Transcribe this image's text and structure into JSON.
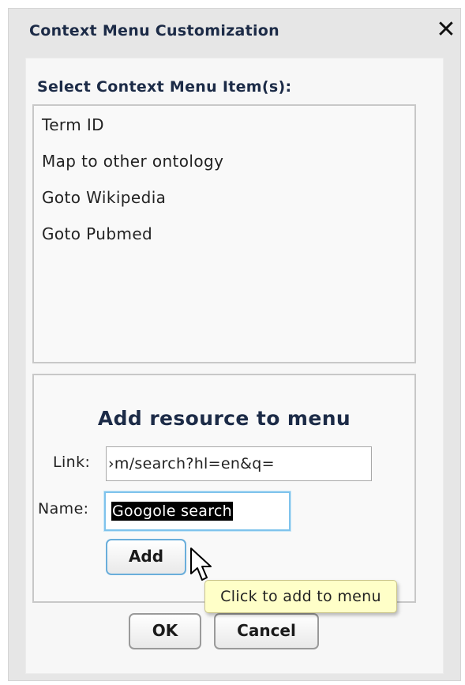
{
  "dialog": {
    "title": "Context Menu Customization",
    "close_icon": "close-icon"
  },
  "menu_items": {
    "label": "Select Context Menu Item(s):",
    "items": [
      "Term ID",
      "Map to other ontology",
      "Goto Wikipedia",
      "Goto Pubmed"
    ]
  },
  "resource": {
    "heading": "Add resource to menu",
    "link_label": "Link:",
    "link_value": "›m/search?hl=en&q=",
    "name_label": "Name:",
    "name_value": "Googole search",
    "add_label": "Add",
    "tooltip": "Click to add to menu"
  },
  "footer": {
    "ok_label": "OK",
    "cancel_label": "Cancel"
  },
  "colors": {
    "dialog_bg": "#e6e6e6",
    "title_text": "#1c2b47",
    "focus_border": "#7fc3ec",
    "tooltip_bg": "#ffffc8",
    "selection_bg": "#000000"
  }
}
